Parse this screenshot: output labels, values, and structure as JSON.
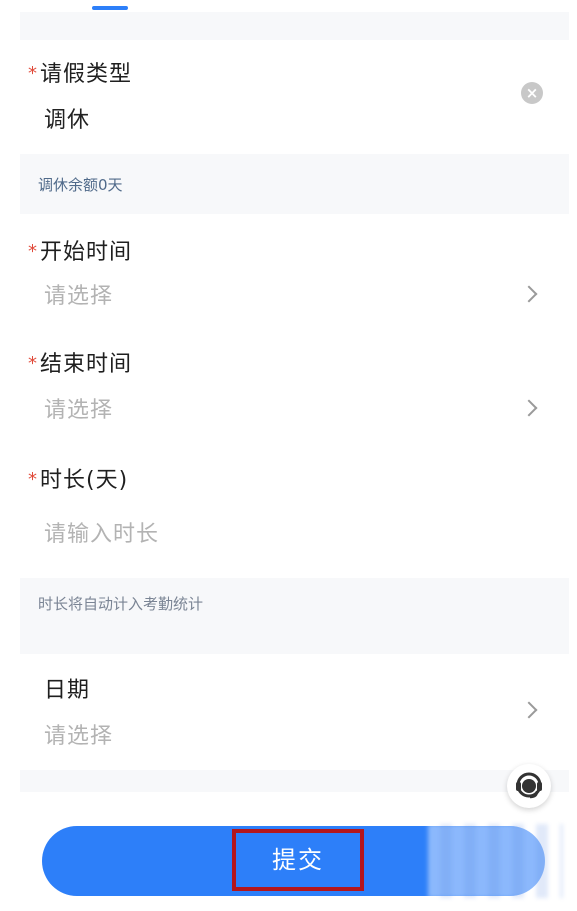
{
  "form": {
    "leave_type": {
      "label": "请假类型",
      "value": "调休",
      "required_mark": "*"
    },
    "balance_hint": "调休余额0天",
    "start_time": {
      "label": "开始时间",
      "placeholder": "请选择",
      "required_mark": "*"
    },
    "end_time": {
      "label": "结束时间",
      "placeholder": "请选择",
      "required_mark": "*"
    },
    "duration": {
      "label": "时长(天)",
      "placeholder": "请输入时长",
      "required_mark": "*"
    },
    "duration_hint": "时长将自动计入考勤统计",
    "date": {
      "label": "日期",
      "placeholder": "请选择"
    }
  },
  "actions": {
    "submit_label": "提交"
  },
  "icons": {
    "clear": "close-circle-icon",
    "chevron": "chevron-right-icon",
    "service": "customer-service-icon"
  },
  "colors": {
    "accent": "#2d7ff9",
    "required": "#e04a3a",
    "highlight": "#b4161b"
  }
}
